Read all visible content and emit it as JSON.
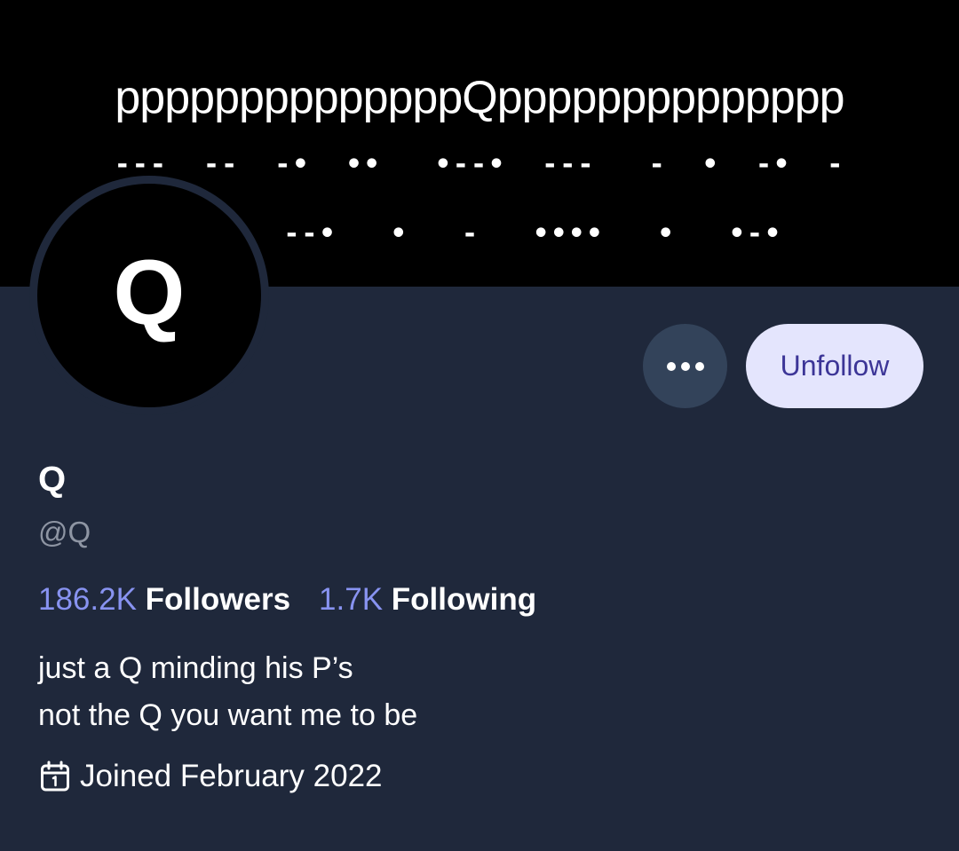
{
  "banner": {
    "title": "ppppppppppppppQpppppppppppppp",
    "morse_line_1": "---  --  -•  ••   •--•  ---   -  •  -•  -",
    "morse_line_2": "  --  --•   •   -   ••••   •   •-•"
  },
  "avatar": {
    "letter": "Q"
  },
  "actions": {
    "more_icon": "ellipsis-icon",
    "unfollow_label": "Unfollow"
  },
  "profile": {
    "display_name": "Q",
    "handle": "@Q",
    "followers_count": "186.2K",
    "followers_label": "Followers",
    "following_count": "1.7K",
    "following_label": "Following",
    "bio_line_1": "just a Q minding his P’s",
    "bio_line_2": "not the Q you want me to be",
    "joined_icon": "calendar-icon",
    "joined": "Joined February 2022"
  },
  "colors": {
    "background": "#1f283b",
    "banner": "#000000",
    "accent_link": "#8893f1",
    "button_primary_bg": "#e4e5fd",
    "button_primary_text": "#3c3597",
    "button_secondary_bg": "#33435a",
    "muted_text": "#8e95a3"
  }
}
